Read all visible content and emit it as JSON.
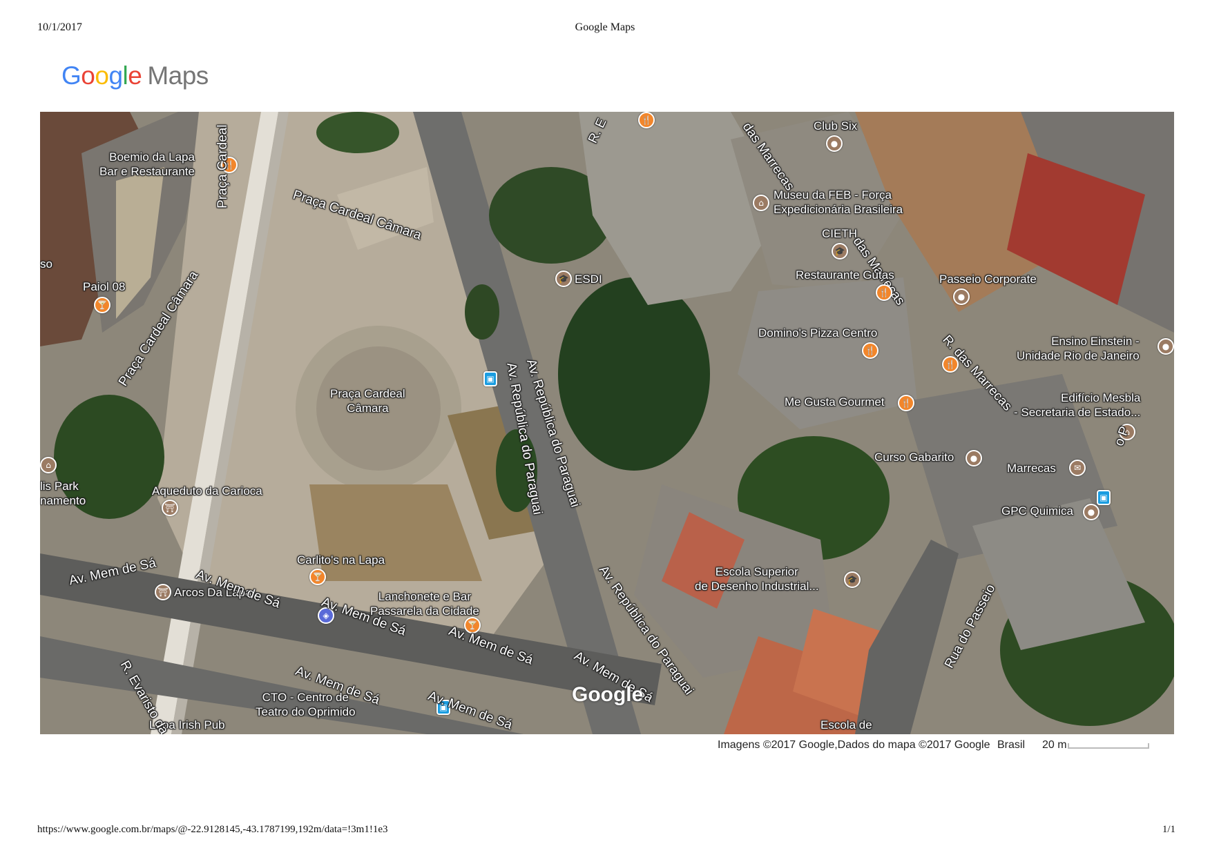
{
  "print_header": {
    "date": "10/1/2017",
    "title": "Google Maps"
  },
  "logo": {
    "text_google": "Google",
    "text_maps": "Maps"
  },
  "map": {
    "view": "satellite",
    "labels": {
      "boemio": "Boemio da Lapa\nBar e Restaurante",
      "paiol": "Paiol 08",
      "so": "so",
      "praca_cardeal_camara_plaza": "Praça Cardeal Câmara",
      "praca_cardeal_camara_center": "Praça Cardeal\nCâmara",
      "praca_cardeal_road": "Praça Cardeal Câmara",
      "praca_cardeal_top": "Praça Cardeal",
      "aqueduto": "Aqueduto da Carioca",
      "lis_park": "lis Park\nnamento",
      "carlitos": "Carlito's na Lapa",
      "arcos": "Arcos Da Lapa",
      "lanchonete": "Lanchonete e Bar\nPassarela da Cidade",
      "cto": "CTO - Centro de\nTeatro do Oprimido",
      "lapa_irish": "Lapa Irish Pub",
      "esdi": "ESDI",
      "club_six": "Club Six",
      "museu_feb": "Museu da FEB - Força\nExpedicionária Brasileira",
      "cieth": "CIETH",
      "restaurante_gutas": "Restaurante Gutas",
      "passeio_corporate": "Passeio Corporate",
      "dominos": "Domino's Pizza Centro",
      "ensino_einstein": "Ensino Einstein -\nUnidade Rio de Janeiro",
      "me_gusta": "Me Gusta Gourmet",
      "edificio_mesbla": "Edifício Mesbla\n- Secretaria de Estado...",
      "curso_gabarito": "Curso Gabarito",
      "marrecas": "Marrecas",
      "gpc_quimica": "GPC Quimica",
      "escola_superior": "Escola Superior\nde Desenho Industrial...",
      "escola_de": "Escola de"
    },
    "roads": {
      "mem_de_sa_1": "Av. Mem de Sá",
      "mem_de_sa_2": "Av. Mem de Sá",
      "mem_de_sa_3": "Av. Mem de Sá",
      "mem_de_sa_4": "Av. Mem de Sá",
      "mem_de_sa_5": "Av. Mem de Sá",
      "mem_de_sa_6": "Av. Mem de Sá",
      "mem_de_sa_7": "Av. Mem de Sá",
      "republica_paraguai_1": "Av. República do Paraguai",
      "republica_paraguai_2": "Av. República do Paraguai",
      "republica_paraguai_3": "Av. República do Paraguai",
      "r_evaristo": "R. Evaristo da",
      "r_e_top": "R. E",
      "das_marrecas_1": "das Marrecas",
      "das_marrecas_2": "das Marrecas",
      "r_das_marrecas": "R. das Marrecas",
      "rua_do_passeio": "Rua do Passeio",
      "o_p": "o P"
    },
    "watermark": "Google"
  },
  "attribution": {
    "imagery": "Imagens ©2017 Google,Dados do mapa ©2017 Google",
    "region": "Brasil",
    "scale": "20 m"
  },
  "print_footer": {
    "url": "https://www.google.com.br/maps/@-22.9128145,-43.1787199,192m/data=!3m1!1e3",
    "page": "1/1"
  },
  "pin_colors": {
    "food": "#F2862B",
    "poi": "#9B7B63",
    "transit": "#1a9de1",
    "shopping": "#5a6ad8"
  }
}
